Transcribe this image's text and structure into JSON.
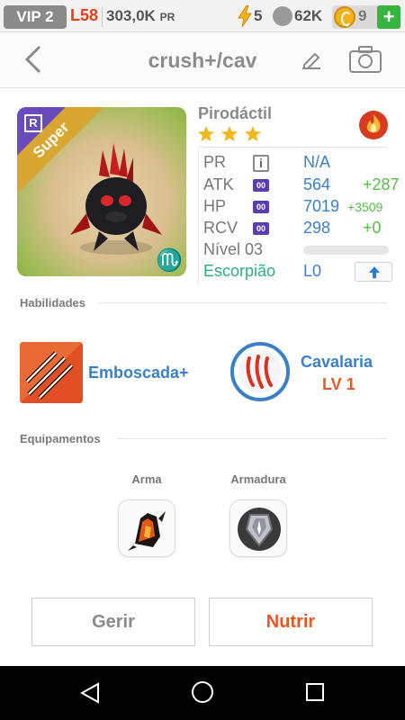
{
  "status": {
    "vip": "VIP 2",
    "level": "L58",
    "power": "303,0K",
    "power_unit": "PR",
    "energy": "5",
    "paws": "62K",
    "coins": "9",
    "add": "+"
  },
  "header": {
    "title": "crush+/cav"
  },
  "monster": {
    "rarity_letter": "R",
    "ribbon": "Super",
    "zodiac_glyph": "♏",
    "name": "Pirodáctil",
    "stars": 3,
    "element": "fire"
  },
  "stats": {
    "pr_label": "PR",
    "pr_info": "i",
    "pr_value": "N/A",
    "atk_label": "ATK",
    "atk_badge": "00",
    "atk_value": "564",
    "atk_bonus": "+287",
    "hp_label": "HP",
    "hp_badge": "00",
    "hp_value": "7019",
    "hp_bonus": "+3509",
    "rcv_label": "RCV",
    "rcv_badge": "00",
    "rcv_value": "298",
    "rcv_bonus": "+0",
    "level_label": "Nível 03",
    "level_progress": 0,
    "sign_label": "Escorpião",
    "sign_value": "L0"
  },
  "abilities": {
    "title": "Habilidades",
    "skill1": "Emboscada+",
    "skill2": "Cavalaria",
    "skill2_level": "LV 1"
  },
  "equipment": {
    "title": "Equipamentos",
    "weapon": "Arma",
    "armor": "Armadura"
  },
  "actions": {
    "manage": "Gerir",
    "feed": "Nutrir"
  },
  "colors": {
    "accent_blue": "#3a80c8",
    "accent_orange": "#e55722",
    "bonus_green": "#58bb45",
    "sign_green": "#2bb07a",
    "rarity_purple": "#6a4bbd"
  }
}
